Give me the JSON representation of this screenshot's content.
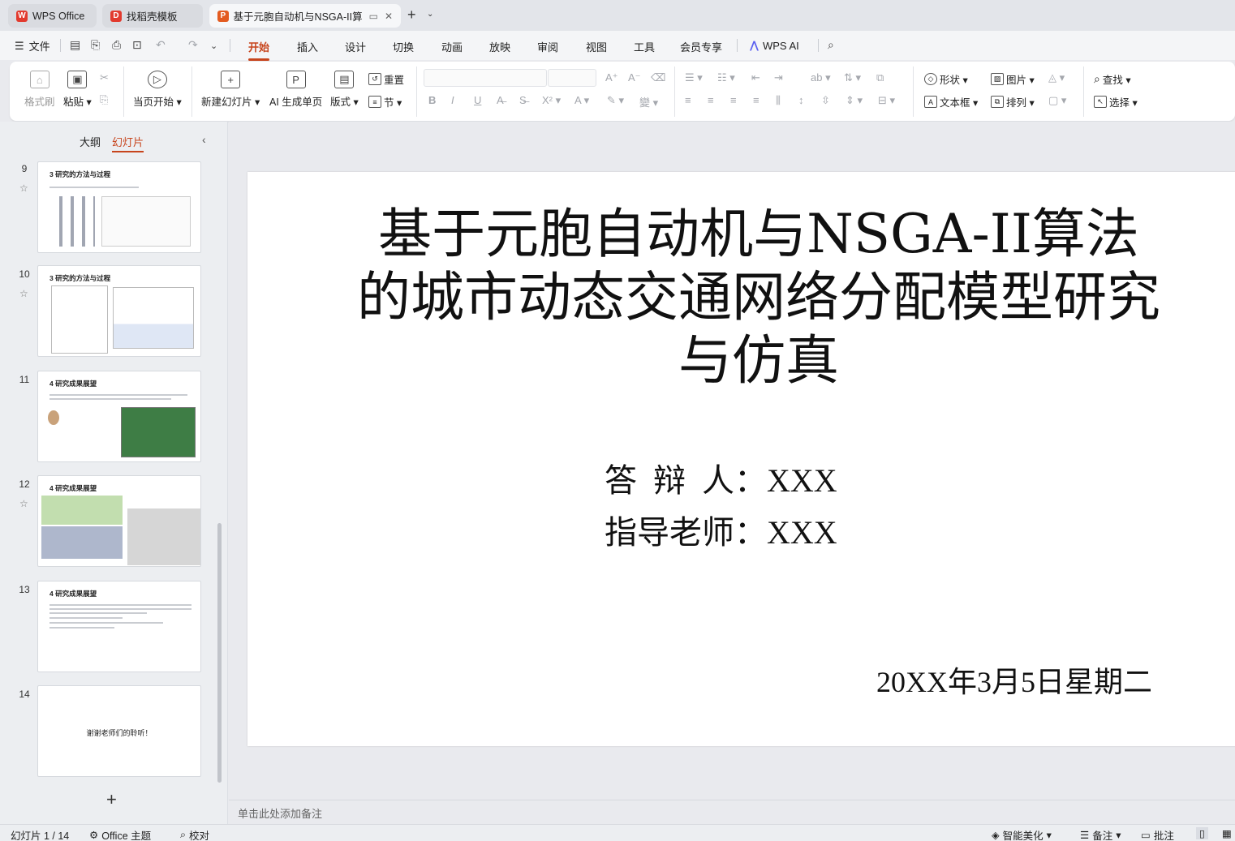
{
  "tabs": [
    {
      "label": "WPS Office",
      "logo": "W",
      "color": "#e23a2e"
    },
    {
      "label": "找稻壳模板",
      "logo": "D",
      "color": "#e23a2e"
    },
    {
      "label": "基于元胞自动机与NSGA-II算",
      "logo": "P",
      "color": "#e35b20"
    }
  ],
  "menu": {
    "file_label": "文件",
    "ribbon_tabs": [
      "开始",
      "插入",
      "设计",
      "切换",
      "动画",
      "放映",
      "审阅",
      "视图",
      "工具",
      "会员专享"
    ],
    "ai_label": "WPS AI"
  },
  "ribbon": {
    "format_painter": "格式刷",
    "paste": "粘贴",
    "start_from_current": "当页开始",
    "new_slide": "新建幻灯片",
    "ai_single_page": "AI 生成单页",
    "layout": "版式",
    "reset": "重置",
    "section": "节",
    "shape": "形状",
    "picture": "图片",
    "textbox": "文本框",
    "arrange": "排列",
    "find": "查找",
    "select": "选择"
  },
  "panel": {
    "outline_tab": "大纲",
    "slides_tab": "幻灯片"
  },
  "thumbnails": [
    {
      "num": "9",
      "title": "3 研究的方法与过程",
      "starred": true
    },
    {
      "num": "10",
      "title": "3 研究的方法与过程",
      "starred": true
    },
    {
      "num": "11",
      "title": "4 研究成果展望",
      "starred": false
    },
    {
      "num": "12",
      "title": "4 研究成果展望",
      "starred": true
    },
    {
      "num": "13",
      "title": "4 研究成果展望",
      "starred": false
    },
    {
      "num": "14",
      "title": "谢谢老师们的聆听！",
      "starred": false
    }
  ],
  "slide": {
    "title": "基于元胞自动机与NSGA-II算法的城市动态交通网络分配模型研究与仿真",
    "presenter": "答  辩  人：XXX",
    "advisor": "指导老师：XXX",
    "date": "20XX年3月5日星期二"
  },
  "notes_placeholder": "单击此处添加备注",
  "status": {
    "slide_counter": "幻灯片 1 / 14",
    "theme": "Office 主题",
    "proof": "校对",
    "smart_beautify": "智能美化",
    "notes": "备注",
    "comments": "批注"
  },
  "accent_color": "#c7441c"
}
